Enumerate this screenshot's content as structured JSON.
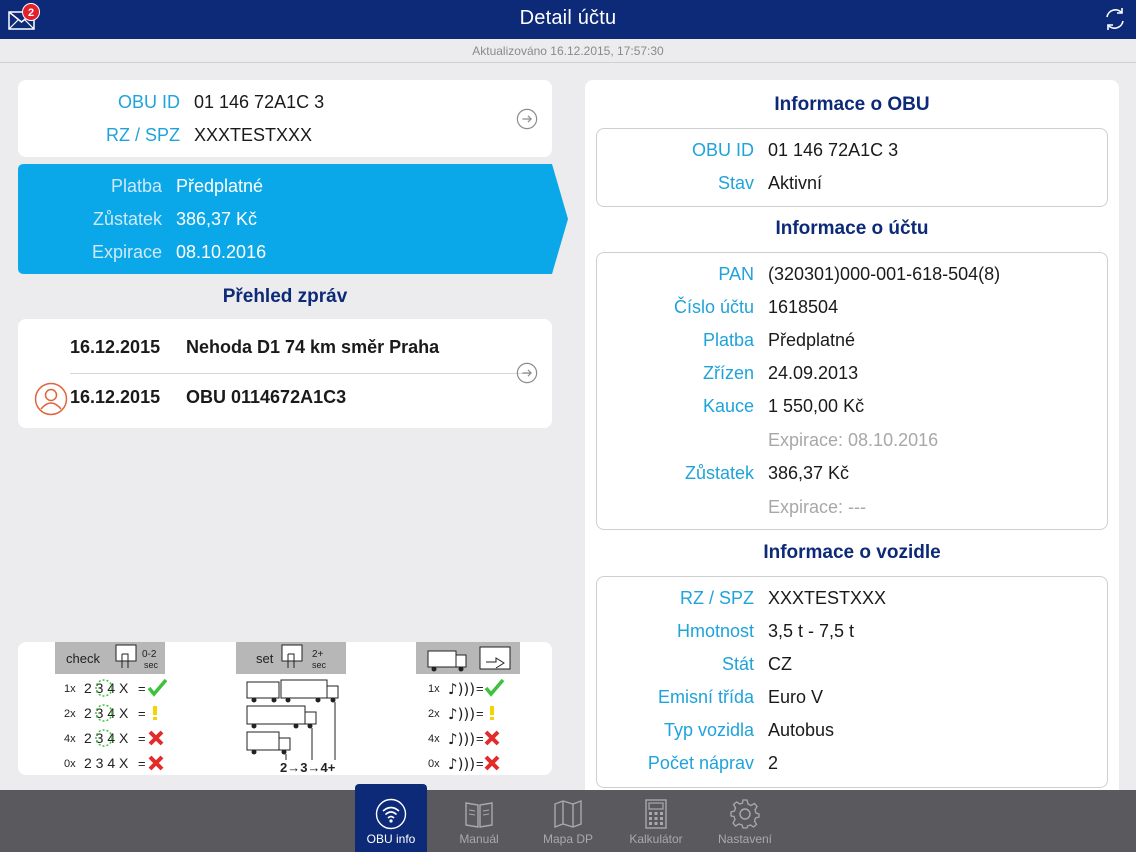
{
  "header": {
    "title": "Detail účtu",
    "mail_badge": "2",
    "updated": "Aktualizováno 16.12.2015, 17:57:30"
  },
  "obu_card": {
    "obu_id_label": "OBU ID",
    "obu_id_value": "01 146 72A1C 3",
    "rz_label": "RZ / SPZ",
    "rz_value": "XXXTESTXXX"
  },
  "payment_card": {
    "platba_label": "Platba",
    "platba_value": "Předplatné",
    "zustatek_label": "Zůstatek",
    "zustatek_value": "386,37 Kč",
    "expirace_label": "Expirace",
    "expirace_value": "08.10.2016"
  },
  "messages": {
    "title": "Přehled zpráv",
    "items": [
      {
        "date": "16.12.2015",
        "text": "Nehoda D1 74 km směr Praha"
      },
      {
        "date": "16.12.2015",
        "text": "OBU 0114672A1C3"
      }
    ]
  },
  "legend": {
    "check_label": "check",
    "check_time": "0-2",
    "set_label": "set",
    "set_time": "2+",
    "sec": "sec",
    "rows": [
      "1x",
      "2x",
      "4x",
      "0x"
    ],
    "digits": "2 3 4 X",
    "axles": "2→3→4+"
  },
  "obu_info": {
    "title": "Informace o OBU",
    "rows": [
      {
        "label": "OBU ID",
        "value": "01 146 72A1C 3"
      },
      {
        "label": "Stav",
        "value": "Aktivní"
      }
    ]
  },
  "account_info": {
    "title": "Informace o účtu",
    "rows": [
      {
        "label": "PAN",
        "value": "(320301)000-001-618-504(8)"
      },
      {
        "label": "Číslo účtu",
        "value": "1618504"
      },
      {
        "label": "Platba",
        "value": "Předplatné"
      },
      {
        "label": "Zřízen",
        "value": "24.09.2013"
      },
      {
        "label": "Kauce",
        "value": "1 550,00 Kč"
      },
      {
        "label": "",
        "value": "Expirace: 08.10.2016"
      },
      {
        "label": "Zůstatek",
        "value": "386,37 Kč"
      },
      {
        "label": "",
        "value": "Expirace: ---"
      }
    ]
  },
  "vehicle_info": {
    "title": "Informace o vozidle",
    "rows": [
      {
        "label": "RZ / SPZ",
        "value": "XXXTESTXXX"
      },
      {
        "label": "Hmotnost",
        "value": "3,5 t - 7,5 t"
      },
      {
        "label": "Stát",
        "value": "CZ"
      },
      {
        "label": "Emisní třída",
        "value": "Euro V"
      },
      {
        "label": "Typ vozidla",
        "value": "Autobus"
      },
      {
        "label": "Počet náprav",
        "value": "2"
      }
    ]
  },
  "tabs": [
    {
      "label": "OBU info",
      "icon": "wifi-icon",
      "active": true
    },
    {
      "label": "Manuál",
      "icon": "book-icon"
    },
    {
      "label": "Mapa DP",
      "icon": "map-icon"
    },
    {
      "label": "Kalkulátor",
      "icon": "calculator-icon"
    },
    {
      "label": "Nastavení",
      "icon": "gear-icon"
    }
  ],
  "colors": {
    "header": "#0d2a78",
    "accent": "#1fa3da",
    "payment_bg": "#0aa8e8",
    "tabbar": "#5a5a5e"
  }
}
